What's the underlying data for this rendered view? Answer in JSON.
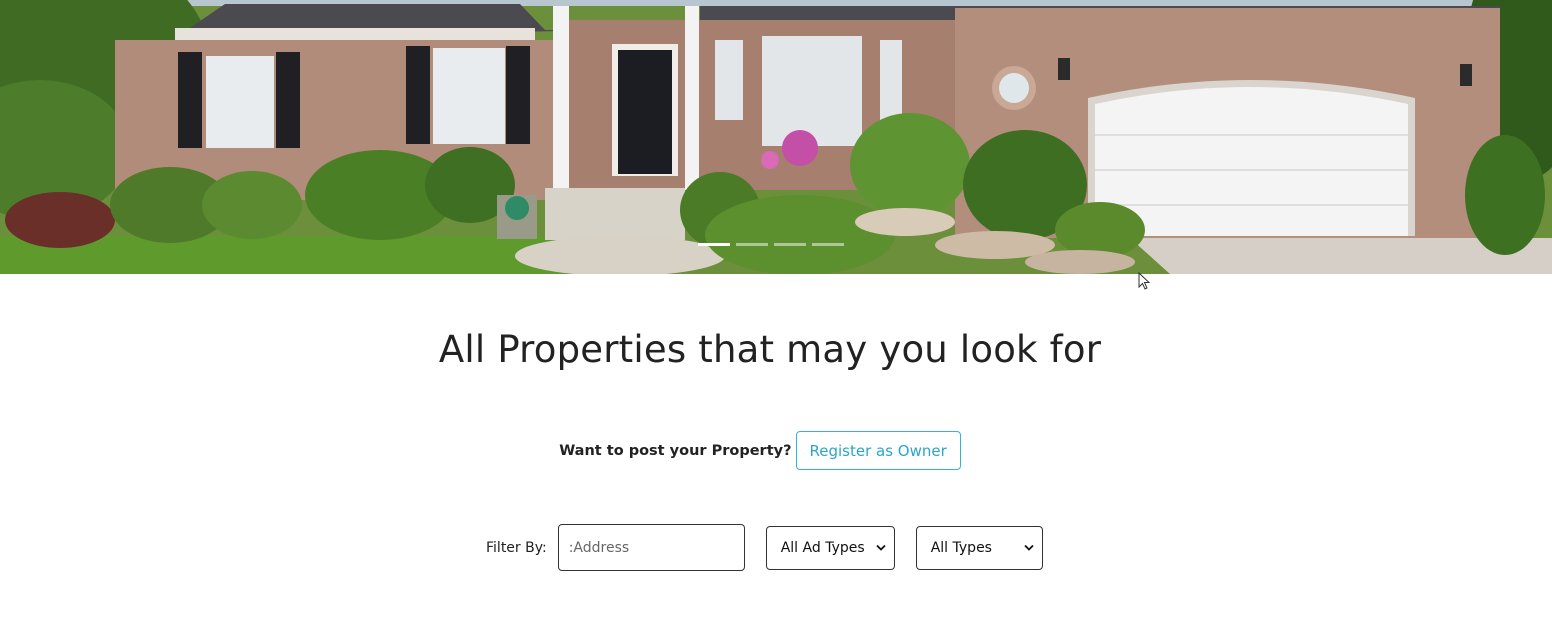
{
  "hero": {
    "image_description": "house",
    "slides": [
      {
        "active": true
      },
      {
        "active": false
      },
      {
        "active": false
      },
      {
        "active": false
      }
    ]
  },
  "main": {
    "title": "All Properties that may you look for",
    "owner_prompt": {
      "question": "Want to post your Property?",
      "button_label": "Register as Owner"
    },
    "filter": {
      "label": "Filter By:",
      "address_placeholder": ":Address",
      "address_value": "",
      "ad_type_selected": "All Ad Types",
      "type_selected": "All Types"
    }
  },
  "colors": {
    "accent": "#2aa6c6",
    "text": "#222222"
  }
}
